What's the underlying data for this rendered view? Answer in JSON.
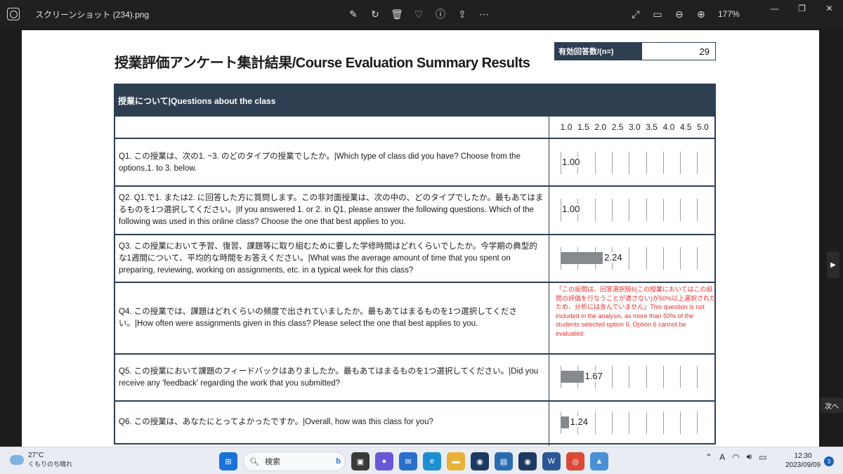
{
  "window": {
    "filename": "スクリーンショット (234).png",
    "zoom": "177%"
  },
  "document": {
    "title": "授業評価アンケート集計結果/Course Evaluation Summary Results",
    "responses_label": "有効回答数/(n=)",
    "responses_value": "29",
    "section_header": "授業について|Questions about the class",
    "scale": [
      "1.0",
      "1.5",
      "2.0",
      "2.5",
      "3.0",
      "3.5",
      "4.0",
      "4.5",
      "5.0"
    ],
    "questions": [
      {
        "text": "Q1. この授業は、次の1. ~3. のどのタイプの授業でしたか。|Which type of class did you have? Choose from the options,1. to 3. below.",
        "value": 1.0,
        "label": "1.00"
      },
      {
        "text": "Q2. Q1.で1. または2. に回答した方に質問します。この非対面授業は、次の中の、どのタイプでしたか。最もあてはまるものを1つ選択してください。|If you answered 1. or 2. in Q1, please answer the following questions. Which of the following was used in this online class? Choose the one that best applies to you.",
        "value": 1.0,
        "label": "1.00"
      },
      {
        "text": "Q3. この授業において予習、復習、課題等に取り組むために要した学修時間はどれくらいでしたか。今学期の典型的な1週間について、平均的な時間をお答えください。|What was the average amount of time that you spent on preparing, reviewing, working on assignments, etc. in a typical week for this class?",
        "value": 2.24,
        "label": "2.24"
      },
      {
        "text": "Q4. この授業では、課題はどれくらいの頻度で出されていましたか。最もあてはまるものを1つ選択してください。|How often were assignments given in this class? Please select the one that best applies to you.",
        "note": "「この設問は、回答選択肢6(この授業においてはこの設問の評価を行なうことが適さない)が50%以上選択されたため、分析には含んでいません」This question is not included in the analysis, as more than 50% of the students selected option 6. Option 6 cannot be evaluated."
      },
      {
        "text": "Q5. この授業において課題のフィードバックはありましたか。最もあてはまるものを1つ選択してください。|Did you receive any 'feedback' regarding the work that you submitted?",
        "value": 1.67,
        "label": "1.67"
      },
      {
        "text": "Q6. この授業は、あなたにとってよかったですか。|Overall, how was this class for you?",
        "value": 1.24,
        "label": "1.24"
      }
    ]
  },
  "viewer": {
    "next_label": "次へ"
  },
  "taskbar": {
    "temperature": "27°C",
    "weather": "くもりのち晴れ",
    "search_placeholder": "検索",
    "time": "12:30",
    "date": "2023/09/09",
    "notifications": "3"
  },
  "chart_data": {
    "type": "bar",
    "categories": [
      "Q1",
      "Q2",
      "Q3",
      "Q5",
      "Q6"
    ],
    "values": [
      1.0,
      1.0,
      2.24,
      1.67,
      1.24
    ],
    "xlim": [
      1.0,
      5.0
    ]
  }
}
